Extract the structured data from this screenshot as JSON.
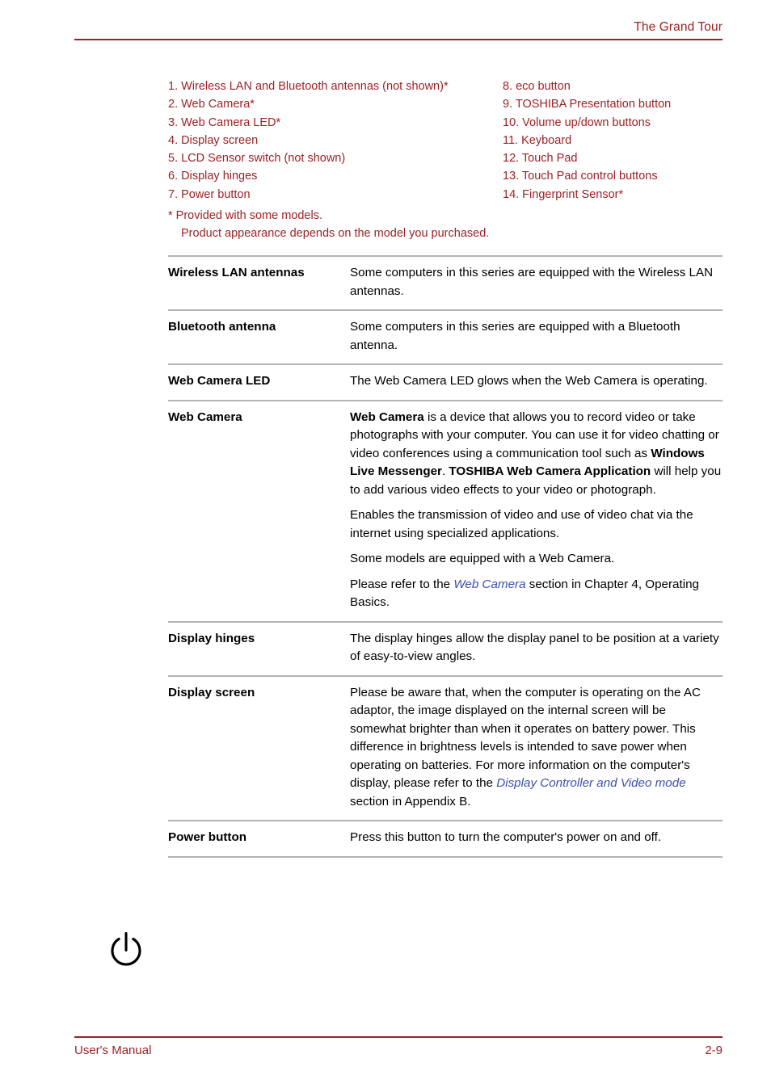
{
  "header": {
    "title": "The Grand Tour"
  },
  "legend": {
    "left_items": [
      "1. Wireless LAN and Bluetooth antennas (not shown)*",
      "2. Web Camera*",
      "3. Web Camera LED*",
      "4. Display screen",
      "5. LCD Sensor switch (not shown)",
      "6. Display hinges",
      "7. Power button"
    ],
    "right_items": [
      "8. eco button",
      "9. TOSHIBA Presentation button",
      "10. Volume up/down buttons",
      "11. Keyboard",
      "12. Touch Pad",
      "13. Touch Pad control buttons",
      "14. Fingerprint Sensor*"
    ],
    "note_1": "* Provided with some models.",
    "note_2": "Product appearance depends on the model you purchased."
  },
  "table": {
    "rows": [
      {
        "term": "Wireless LAN antennas",
        "paragraphs": [
          "Some computers in this series are equipped with the Wireless LAN antennas."
        ]
      },
      {
        "term": "Bluetooth antenna",
        "paragraphs": [
          "Some computers in this series are equipped with a Bluetooth antenna."
        ]
      },
      {
        "term": "Web Camera LED",
        "paragraphs": [
          "The Web Camera LED glows when the Web Camera is operating."
        ]
      },
      {
        "term": "Web Camera",
        "p1_b1": "Web Camera",
        "p1_t1": " is a device that allows you to record video or take photographs with your computer. You can use it for video chatting or video conferences using a communication tool such as ",
        "p1_b2": "Windows Live Messenger",
        "p1_t2": ". ",
        "p1_b3": "TOSHIBA Web Camera Application",
        "p1_t3": " will help you to add various video effects to your video or photograph.",
        "p2": "Enables the transmission of video and use of video chat via the internet using specialized applications.",
        "p3": "Some models are equipped with a Web Camera.",
        "p4_t1": "Please refer to the ",
        "p4_link": "Web Camera",
        "p4_t2": " section in Chapter 4, Operating Basics."
      },
      {
        "term": "Display hinges",
        "paragraphs": [
          "The display hinges allow the display panel to be position at a variety of easy-to-view angles."
        ]
      },
      {
        "term": "Display screen",
        "p1_t1": "Please be aware that, when the computer is operating on the AC adaptor, the image displayed on the internal screen will be somewhat brighter than when it operates on battery power. This difference in brightness levels is intended to save power when operating on batteries. For more information on the computer's display, please refer to the ",
        "p1_link": "Display Controller and Video mode",
        "p1_t2": " section in Appendix B."
      },
      {
        "term": "Power button",
        "icon": "power-icon",
        "paragraphs": [
          "Press this button to turn the computer's power on and off."
        ]
      }
    ]
  },
  "footer": {
    "left": "User's Manual",
    "right": "2-9"
  },
  "colors": {
    "accent_red": "#9c2125",
    "rule_gray": "#b3b3b3",
    "xref_blue": "#3b4fb0"
  }
}
